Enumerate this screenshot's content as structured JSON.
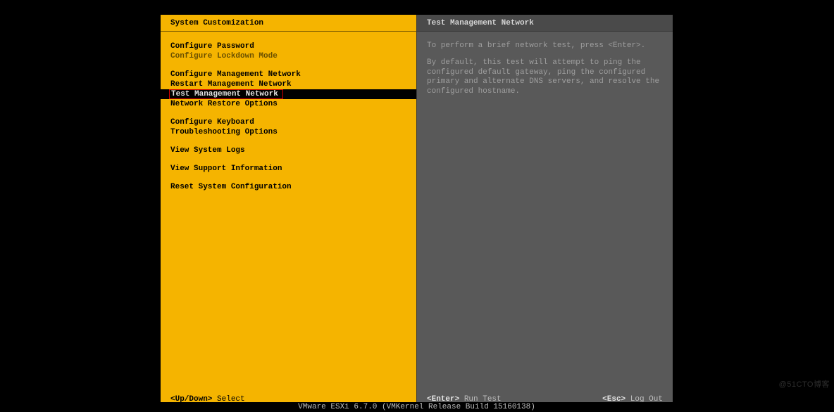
{
  "left": {
    "title": "System Customization",
    "groups": [
      [
        {
          "label": "Configure Password",
          "state": "normal"
        },
        {
          "label": "Configure Lockdown Mode",
          "state": "disabled"
        }
      ],
      [
        {
          "label": "Configure Management Network",
          "state": "normal"
        },
        {
          "label": "Restart Management Network",
          "state": "normal"
        },
        {
          "label": "Test Management Network",
          "state": "selected"
        },
        {
          "label": "Network Restore Options",
          "state": "normal"
        }
      ],
      [
        {
          "label": "Configure Keyboard",
          "state": "normal"
        },
        {
          "label": "Troubleshooting Options",
          "state": "normal"
        }
      ],
      [
        {
          "label": "View System Logs",
          "state": "normal"
        }
      ],
      [
        {
          "label": "View Support Information",
          "state": "normal"
        }
      ],
      [
        {
          "label": "Reset System Configuration",
          "state": "normal"
        }
      ]
    ],
    "footer_key": "<Up/Down>",
    "footer_action": "Select"
  },
  "right": {
    "title": "Test Management Network",
    "para1": "To perform a brief network test, press <Enter>.",
    "para2": "By default, this test will attempt to ping the configured default gateway, ping the configured primary and alternate DNS servers, and resolve the configured hostname.",
    "footer_left_key": "<Enter>",
    "footer_left_action": "Run Test",
    "footer_right_key": "<Esc>",
    "footer_right_action": "Log Out"
  },
  "bottom": "VMware ESXi 6.7.0 (VMKernel Release Build 15160138)",
  "watermark": "@51CTO博客"
}
